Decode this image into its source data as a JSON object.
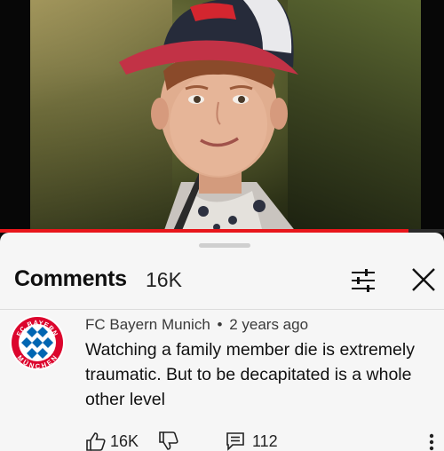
{
  "comments_panel": {
    "title": "Comments",
    "count": "16K"
  },
  "comment": {
    "author": "FC Bayern Munich",
    "separator": "•",
    "time_ago": "2 years ago",
    "text": "Watching a family member die is extremely traumatic. But to be decapitated is a whole other level",
    "like_count": "16K",
    "reply_count": "112",
    "avatar_ring_text": [
      "FC BAYERN",
      "MÜNCHEN"
    ]
  },
  "video": {
    "progress_fraction": 0.92
  },
  "colors": {
    "accent_red": "#e8161b",
    "bayern_red": "#dc052d",
    "bayern_blue": "#0066b2",
    "sheet_bg": "#f6f6f6"
  },
  "icons": [
    "filter-icon",
    "close-icon",
    "thumbs-up-icon",
    "thumbs-down-icon",
    "reply-icon",
    "more-vertical-icon"
  ]
}
